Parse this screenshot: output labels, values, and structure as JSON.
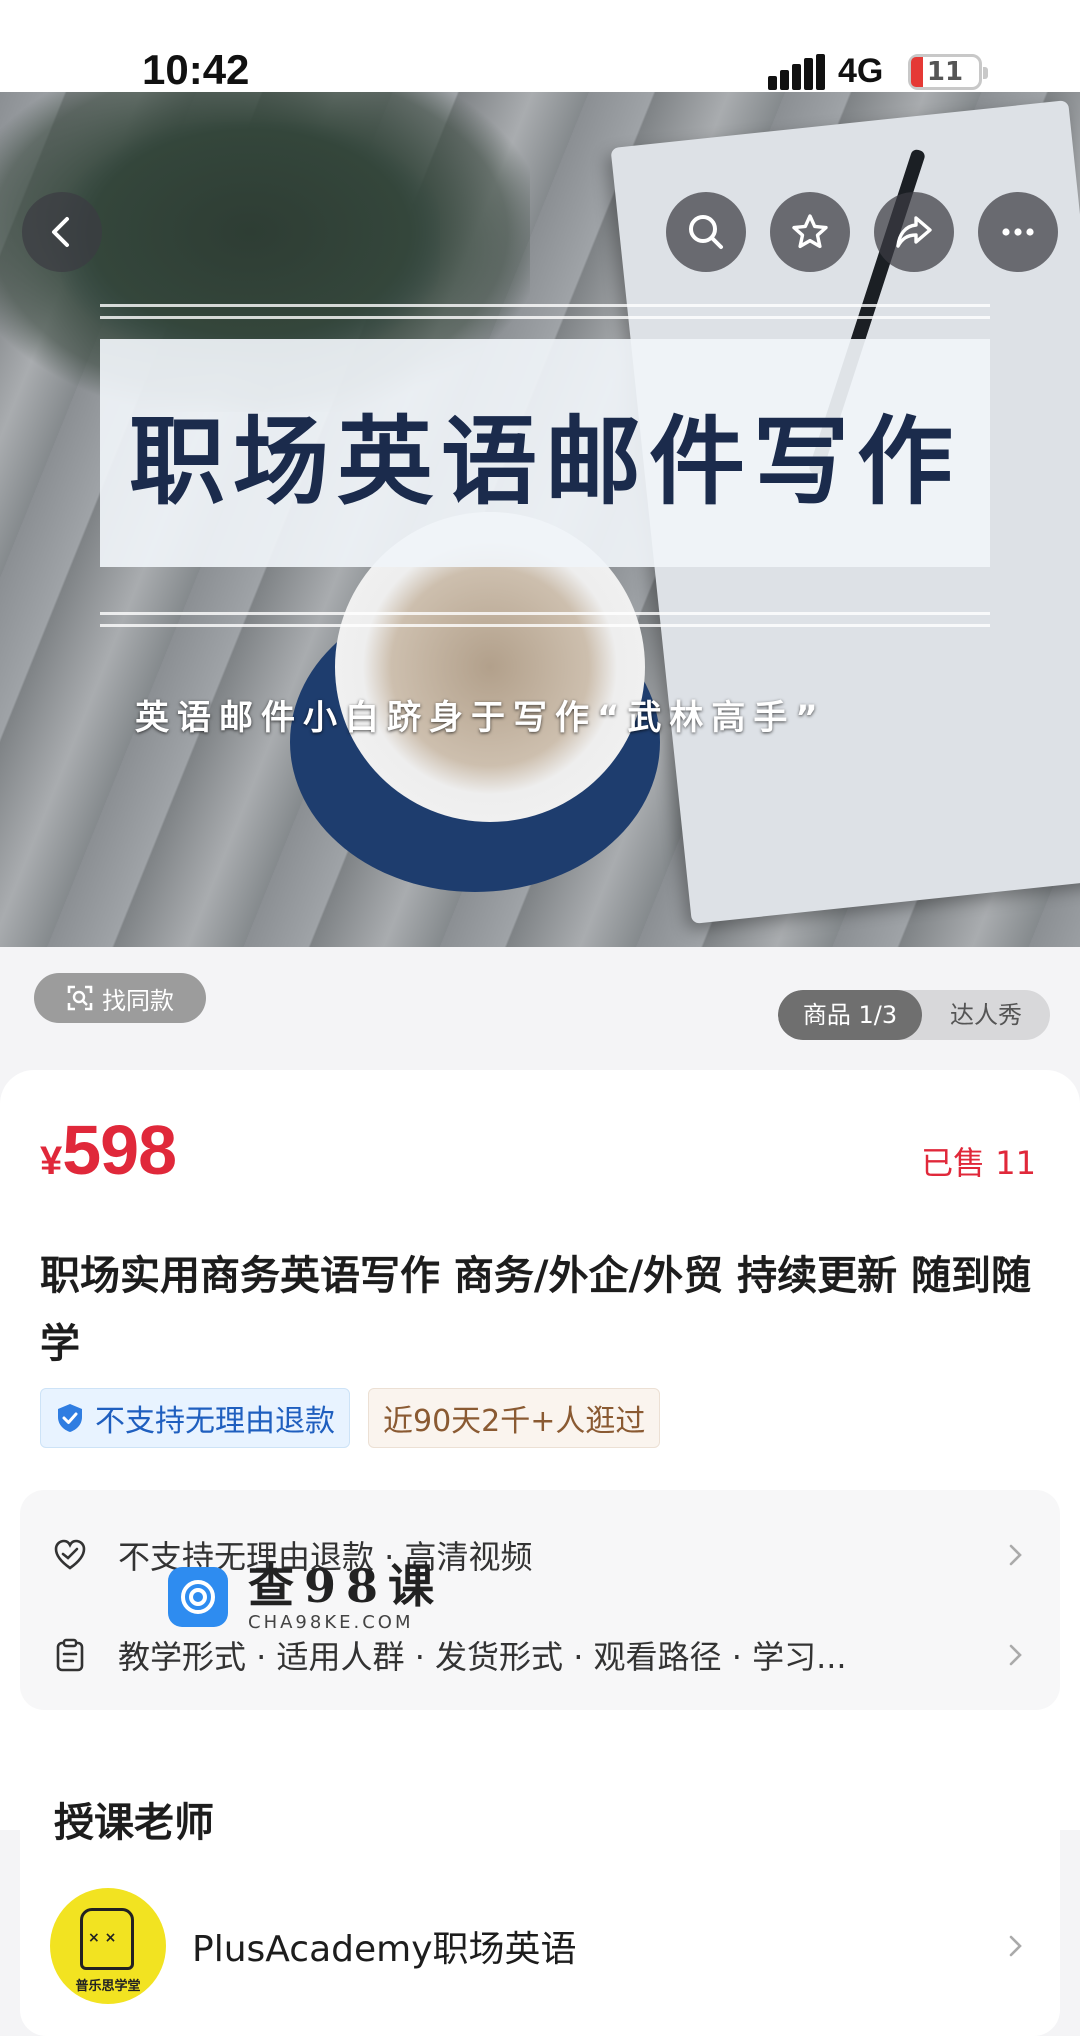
{
  "status_bar": {
    "time": "10:42",
    "network": "4G",
    "battery_level": "11",
    "battery_color": "#e53935"
  },
  "hero": {
    "title": "职场英语邮件写作",
    "subtitle": "英语邮件小白跻身于写作“武林高手”",
    "nav_icons": [
      "back-icon",
      "search-icon",
      "star-icon",
      "share-icon",
      "more-icon"
    ]
  },
  "find_similar": {
    "label": "找同款",
    "icon": "scan-icon"
  },
  "media_tabs": [
    {
      "label": "商品 1/3",
      "active": true
    },
    {
      "label": "达人秀",
      "active": false
    }
  ],
  "product": {
    "currency": "¥",
    "price": "598",
    "sold": "已售 11",
    "title": "职场实用商务英语写作 商务/外企/外贸 持续更新 随到随学",
    "tags": {
      "refund": "不支持无理由退款",
      "visits": "近90天2千+人逛过"
    },
    "price_color": "#e0283a"
  },
  "info_rows": [
    {
      "icon": "heart-shield-icon",
      "text": "不支持无理由退款 · 高清视频"
    },
    {
      "icon": "clipboard-icon",
      "text": "教学形式 · 适用人群 · 发货形式 · 观看路径 · 学习..."
    }
  ],
  "watermark": {
    "text": "查98课",
    "sub": "CHA98KE.COM"
  },
  "teacher": {
    "heading": "授课老师",
    "name": "PlusAcademy职场英语",
    "avatar_caption": "普乐思学堂"
  }
}
